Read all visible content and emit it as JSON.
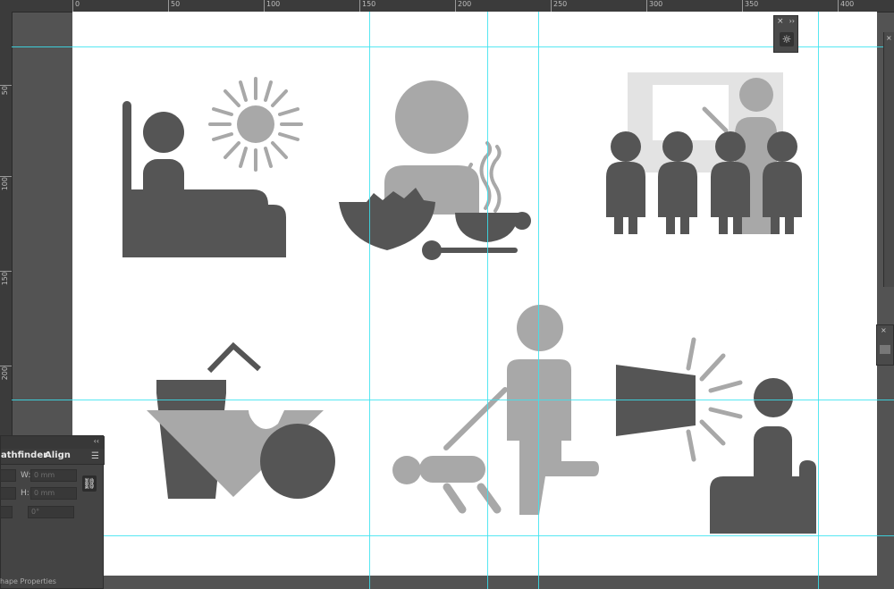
{
  "rulers": {
    "top": [
      "0",
      "50",
      "100",
      "150",
      "200",
      "250",
      "300",
      "350",
      "400"
    ],
    "left": [
      "50",
      "100",
      "150",
      "200"
    ]
  },
  "illustrations": [
    {
      "name": "person-in-bed-with-sun"
    },
    {
      "name": "person-eating-breakfast"
    },
    {
      "name": "classroom-presentation"
    },
    {
      "name": "fast-food-meal"
    },
    {
      "name": "walking-the-dog"
    },
    {
      "name": "loud-speaker-at-night"
    }
  ],
  "colors": {
    "dark": "#555555",
    "light": "#a8a8a8",
    "pale": "#e3e3e3",
    "guide": "#39e3f0"
  },
  "mini_panel": {
    "icon": "sun-icon",
    "glyph": "☼"
  },
  "pathfinder_panel": {
    "tab_pathfinder": "athfinder",
    "tab_align": "Align",
    "w_label": "W:",
    "w_value": "0 mm",
    "h_label": "H:",
    "h_value": "0 mm",
    "angle_value": "0°",
    "link_glyph": "⛓",
    "footer": "hape Properties",
    "menu_icon": "☰",
    "collapse": "‹‹"
  },
  "dock": {
    "close": "×",
    "collapse": "››"
  }
}
